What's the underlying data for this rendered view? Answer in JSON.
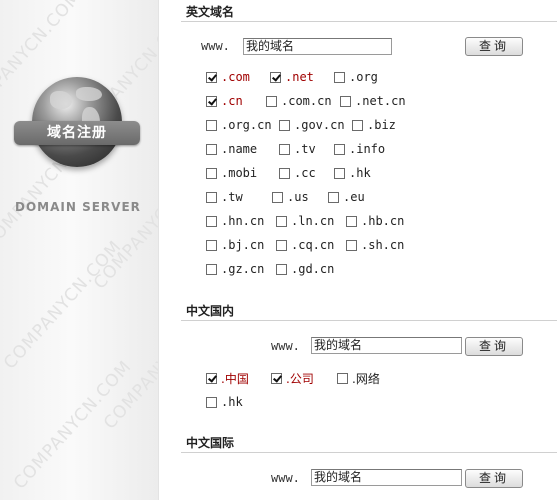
{
  "left_panel": {
    "watermark_text": "COMPANYCN.COM",
    "badge_label": "域名注册",
    "caption": "DOMAIN SERVER"
  },
  "sections": [
    {
      "title": "英文域名",
      "www_prefix": "www.",
      "input_value": "我的域名",
      "button_label": "查询",
      "options": [
        {
          "label": ".com",
          "checked": true
        },
        {
          "label": ".net",
          "checked": true
        },
        {
          "label": ".org",
          "checked": false
        },
        {
          "label": ".cn",
          "checked": true
        },
        {
          "label": ".com.cn",
          "checked": false
        },
        {
          "label": ".net.cn",
          "checked": false
        },
        {
          "label": ".org.cn",
          "checked": false
        },
        {
          "label": ".gov.cn",
          "checked": false
        },
        {
          "label": ".biz",
          "checked": false
        },
        {
          "label": ".name",
          "checked": false
        },
        {
          "label": ".tv",
          "checked": false
        },
        {
          "label": ".info",
          "checked": false
        },
        {
          "label": ".mobi",
          "checked": false
        },
        {
          "label": ".cc",
          "checked": false
        },
        {
          "label": ".hk",
          "checked": false
        },
        {
          "label": ".tw",
          "checked": false
        },
        {
          "label": ".us",
          "checked": false
        },
        {
          "label": ".eu",
          "checked": false
        },
        {
          "label": ".hn.cn",
          "checked": false
        },
        {
          "label": ".ln.cn",
          "checked": false
        },
        {
          "label": ".hb.cn",
          "checked": false
        },
        {
          "label": ".bj.cn",
          "checked": false
        },
        {
          "label": ".cq.cn",
          "checked": false
        },
        {
          "label": ".sh.cn",
          "checked": false
        },
        {
          "label": ".gz.cn",
          "checked": false
        },
        {
          "label": ".gd.cn",
          "checked": false
        }
      ]
    },
    {
      "title": "中文国内",
      "www_prefix": "www.",
      "input_value": "我的域名",
      "button_label": "查询",
      "options": [
        {
          "label": ".中国",
          "checked": true
        },
        {
          "label": ".公司",
          "checked": true
        },
        {
          "label": ".网络",
          "checked": false
        },
        {
          "label": ".hk",
          "checked": false
        }
      ]
    },
    {
      "title": "中文国际",
      "www_prefix": "www.",
      "input_value": "我的域名",
      "button_label": "查询"
    }
  ],
  "colors": {
    "checked_label": "#a00000",
    "panel_bg": "#f1f1f1",
    "badge_bg": "#7a7a7a"
  }
}
